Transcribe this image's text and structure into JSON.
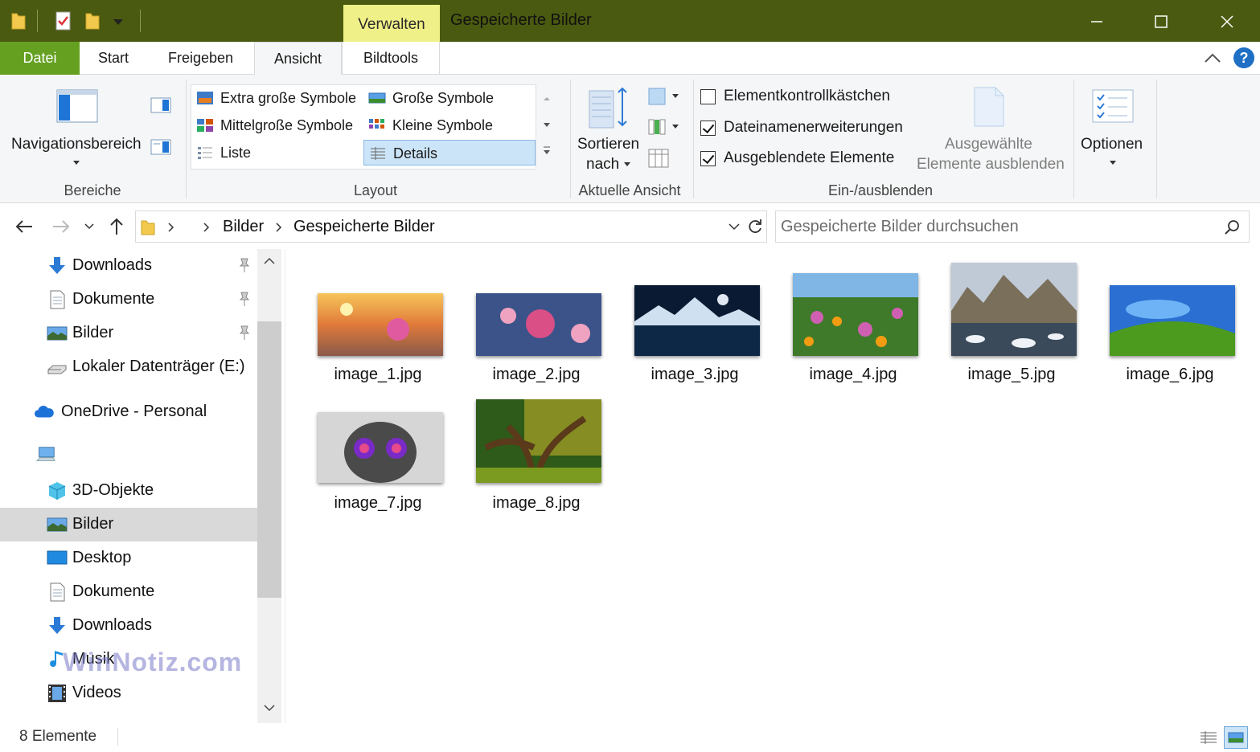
{
  "window": {
    "title": "Gespeicherte Bilder",
    "contextual_tab": "Verwalten"
  },
  "tabs": [
    "Datei",
    "Start",
    "Freigeben",
    "Ansicht",
    "Bildtools"
  ],
  "ribbon": {
    "panes": {
      "nav_pane_label": "Navigationsbereich",
      "group_label": "Bereiche"
    },
    "layout": {
      "items": [
        "Extra große Symbole",
        "Große Symbole",
        "Mittelgroße Symbole",
        "Kleine Symbole",
        "Liste",
        "Details"
      ],
      "selected": "Details",
      "group_label": "Layout"
    },
    "current_view": {
      "sort_label_line1": "Sortieren",
      "sort_label_line2": "nach",
      "group_label": "Aktuelle Ansicht"
    },
    "show_hide": {
      "checkboxes": [
        {
          "label": "Elementkontrollkästchen",
          "checked": false
        },
        {
          "label": "Dateinamenerweiterungen",
          "checked": true
        },
        {
          "label": "Ausgeblendete Elemente",
          "checked": true
        }
      ],
      "hide_selected_line1": "Ausgewählte",
      "hide_selected_line2": "Elemente ausblenden",
      "group_label": "Ein-/ausblenden"
    },
    "options_label": "Optionen"
  },
  "address": {
    "breadcrumb": [
      "Bilder",
      "Gespeicherte Bilder"
    ],
    "search_placeholder": "Gespeicherte Bilder durchsuchen"
  },
  "sidebar": {
    "items": [
      {
        "label": "Downloads",
        "icon": "download-arrow-icon",
        "pinned": true
      },
      {
        "label": "Dokumente",
        "icon": "document-icon",
        "pinned": true
      },
      {
        "label": "Bilder",
        "icon": "pictures-icon",
        "pinned": true
      },
      {
        "label": "Lokaler Datenträger (E:)",
        "icon": "drive-icon",
        "pinned": false
      },
      {
        "label": "OneDrive - Personal",
        "icon": "cloud-icon",
        "pinned": false
      },
      {
        "label": "",
        "icon": "computer-icon",
        "pinned": false
      },
      {
        "label": "3D-Objekte",
        "icon": "cube-icon",
        "pinned": false
      },
      {
        "label": "Bilder",
        "icon": "pictures-icon",
        "pinned": false,
        "selected": true
      },
      {
        "label": "Desktop",
        "icon": "desktop-icon",
        "pinned": false
      },
      {
        "label": "Dokumente",
        "icon": "document-icon",
        "pinned": false
      },
      {
        "label": "Downloads",
        "icon": "download-arrow-icon",
        "pinned": false
      },
      {
        "label": "Musik",
        "icon": "music-note-icon",
        "pinned": false
      },
      {
        "label": "Videos",
        "icon": "film-icon",
        "pinned": false
      }
    ],
    "watermark": "WinNotiz.com"
  },
  "files": [
    {
      "name": "image_1.jpg",
      "palette": [
        "#f7c55a",
        "#e07a3a",
        "#8a5a4a"
      ]
    },
    {
      "name": "image_2.jpg",
      "palette": [
        "#2b3d6b",
        "#d94f86",
        "#f0a3c0"
      ]
    },
    {
      "name": "image_3.jpg",
      "palette": [
        "#0a1a33",
        "#2d5f8f",
        "#0d2747"
      ]
    },
    {
      "name": "image_4.jpg",
      "palette": [
        "#7fb6e6",
        "#cf5fb0",
        "#3f7a2a"
      ]
    },
    {
      "name": "image_5.jpg",
      "palette": [
        "#c0cad6",
        "#7a6f5a",
        "#3a4a5a"
      ]
    },
    {
      "name": "image_6.jpg",
      "palette": [
        "#2a6fd1",
        "#7ec4ff",
        "#4c9b1e"
      ]
    },
    {
      "name": "image_7.jpg",
      "palette": [
        "#d6d6d6",
        "#4a4a4a",
        "#7a2ac7"
      ]
    },
    {
      "name": "image_8.jpg",
      "palette": [
        "#2e5a1a",
        "#c2b02a",
        "#5a3a1a"
      ]
    }
  ],
  "status": {
    "count_label": "8 Elemente"
  }
}
